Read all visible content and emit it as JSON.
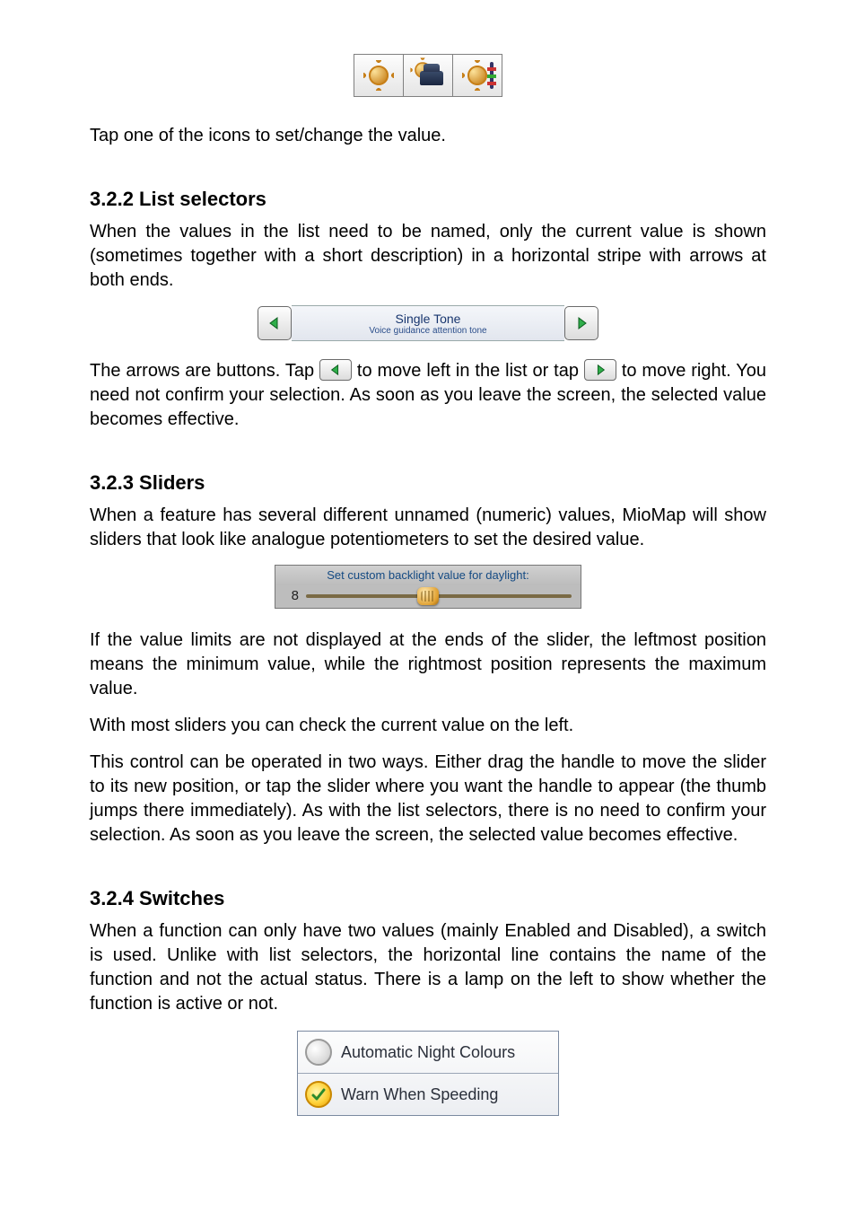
{
  "intro_tap": "Tap one of the icons to set/change the value.",
  "sections": {
    "list_selectors": {
      "heading": "3.2.2  List selectors",
      "para1": "When the values in the list need to be named, only the current value is shown (sometimes together with a short description) in a horizontal stripe with arrows at both ends.",
      "list_title": "Single Tone",
      "list_sub": "Voice guidance attention tone",
      "para2_pre": "The arrows are buttons. Tap ",
      "para2_mid": " to move left in the list or tap ",
      "para2_post": " to move right. You need not confirm your selection. As soon as you leave the screen, the selected value becomes effective."
    },
    "sliders": {
      "heading": "3.2.3  Sliders",
      "para1": "When a feature has several different unnamed (numeric) values, MioMap will show sliders that look like analogue potentiometers to set the desired value.",
      "slider_title": "Set custom backlight value for daylight:",
      "slider_value": "8",
      "para2": "If the value limits are not displayed at the ends of the slider, the leftmost position means the minimum value, while the rightmost position represents the maximum value.",
      "para3": "With most sliders you can check the current value on the left.",
      "para4": "This control can be operated in two ways. Either drag the handle to move the slider to its new position, or tap the slider where you want the handle to appear (the thumb jumps there immediately). As with the list selectors, there is no need to confirm your selection. As soon as you leave the screen, the selected value becomes effective."
    },
    "switches": {
      "heading": "3.2.4  Switches",
      "para1": "When a function can only have two values (mainly Enabled and Disabled), a switch is used. Unlike with list selectors, the horizontal line contains the name of the function and not the actual status. There is a lamp on the left to show whether the function is active or not.",
      "row1": "Automatic Night Colours",
      "row2": "Warn When Speeding"
    }
  }
}
